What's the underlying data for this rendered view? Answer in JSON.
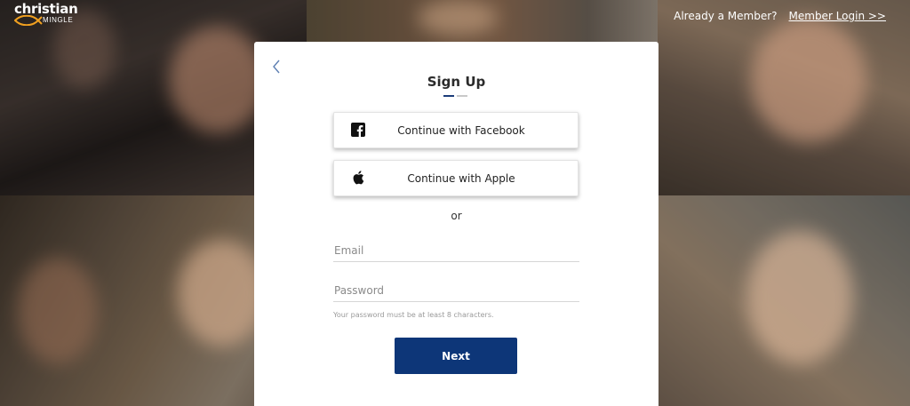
{
  "brand": {
    "line1": "christian",
    "line2": "MINGLE",
    "fish_color": "#f0a020"
  },
  "header": {
    "member_prompt": "Already a Member?",
    "login_link": "Member Login >>"
  },
  "signup": {
    "title": "Sign Up",
    "steps": {
      "current": 1,
      "total": 2
    },
    "facebook_label": "Continue with Facebook",
    "facebook_icon": "facebook-icon",
    "apple_label": "Continue with Apple",
    "apple_icon": "apple-icon",
    "divider": "or",
    "email_placeholder": "Email",
    "password_placeholder": "Password",
    "password_hint": "Your password must be at least 8 characters.",
    "next_label": "Next",
    "accent_color": "#0d3678"
  }
}
